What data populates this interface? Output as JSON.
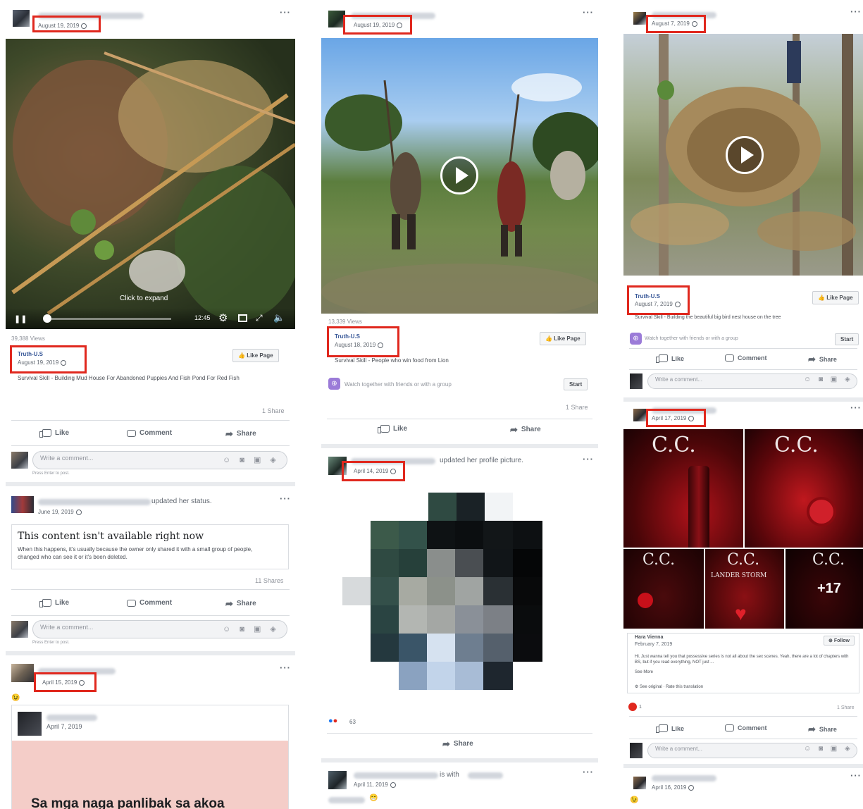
{
  "app": "Facebook",
  "columns": [
    {
      "post1": {
        "date": "August 19, 2019",
        "views": "39,388 Views",
        "overlay_text": "Click to expand",
        "video_time": "12:45",
        "page_name": "Truth-U.S",
        "page_date": "August 19, 2019",
        "like_page": "Like Page",
        "caption": "Survival Skill - Building Mud House For Abandoned Puppies And Fish Pond For Red Fish",
        "shares": "1 Share",
        "actions": [
          "Like",
          "Comment",
          "Share"
        ],
        "comment_placeholder": "Write a comment...",
        "comment_hint": "Press Enter to post."
      },
      "post2": {
        "action_text": "updated her status.",
        "date": "June 19, 2019",
        "unavailable_title": "This content isn't available right now",
        "unavailable_body": "When this happens, it's usually because the owner only shared it with a small group of people, changed who can see it or it's been deleted.",
        "shares": "11 Shares",
        "actions": [
          "Like",
          "Comment",
          "Share"
        ],
        "comment_placeholder": "Write a comment...",
        "comment_hint": "Press Enter to post."
      },
      "post3": {
        "date": "April 15, 2019",
        "emoji": "😉",
        "shared_date": "April 7, 2019",
        "shared_text": "Sa mga naga panlibak sa akoa"
      }
    },
    {
      "post1": {
        "date": "August 19, 2019",
        "views": "13,339 Views",
        "page_name": "Truth-U.S",
        "page_date": "August 18, 2019",
        "like_page": "Like Page",
        "caption": "Survival Skill - People who win food from Lion",
        "watch_text": "Watch together with friends or with a group",
        "start": "Start",
        "shares": "1 Share",
        "actions": [
          "Like",
          "Share"
        ]
      },
      "post2": {
        "action_text": "updated her profile picture.",
        "date": "April 14, 2019",
        "reaction_count": "63",
        "actions": [
          "Share"
        ]
      },
      "post3": {
        "action_text": "is with",
        "date": "April 11, 2019",
        "emoji": "😁"
      }
    },
    {
      "post1": {
        "date": "August 7, 2019",
        "page_name": "Truth-U.S",
        "page_date": "August 7, 2019",
        "like_page": "Like Page",
        "caption": "Survival Skill - Building the beautiful big bird nest house on the tree",
        "watch_text": "Watch together with friends or with a group",
        "start": "Start",
        "actions": [
          "Like",
          "Comment",
          "Share"
        ],
        "comment_placeholder": "Write a comment..."
      },
      "post2": {
        "date": "April 17, 2019",
        "tiles": [
          "C.C.",
          "C.C.",
          "C.C.",
          "C.C.",
          "C.C."
        ],
        "tile_sub": "LANDER STORM",
        "more_count": "+17",
        "author": "Hara Vienna",
        "author_date": "February 7, 2019",
        "follow": "Follow",
        "body": "Hi. Just wanna tell you that possessive series is not all about the sex scenes. Yeah, there are a lot of chapters with BS, but if you read everything, NOT just ...",
        "see_more": "See More",
        "see_original": "See original · Rate this translation",
        "reaction_count": "1",
        "shares": "1 Share",
        "actions": [
          "Like",
          "Comment",
          "Share"
        ],
        "comment_placeholder": "Write a comment..."
      },
      "post3": {
        "date": "April 16, 2019",
        "emoji": "😉"
      }
    }
  ],
  "colors": {
    "highlight": "#e0281e",
    "link": "#385898",
    "feed_bg": "#e9ebee"
  }
}
